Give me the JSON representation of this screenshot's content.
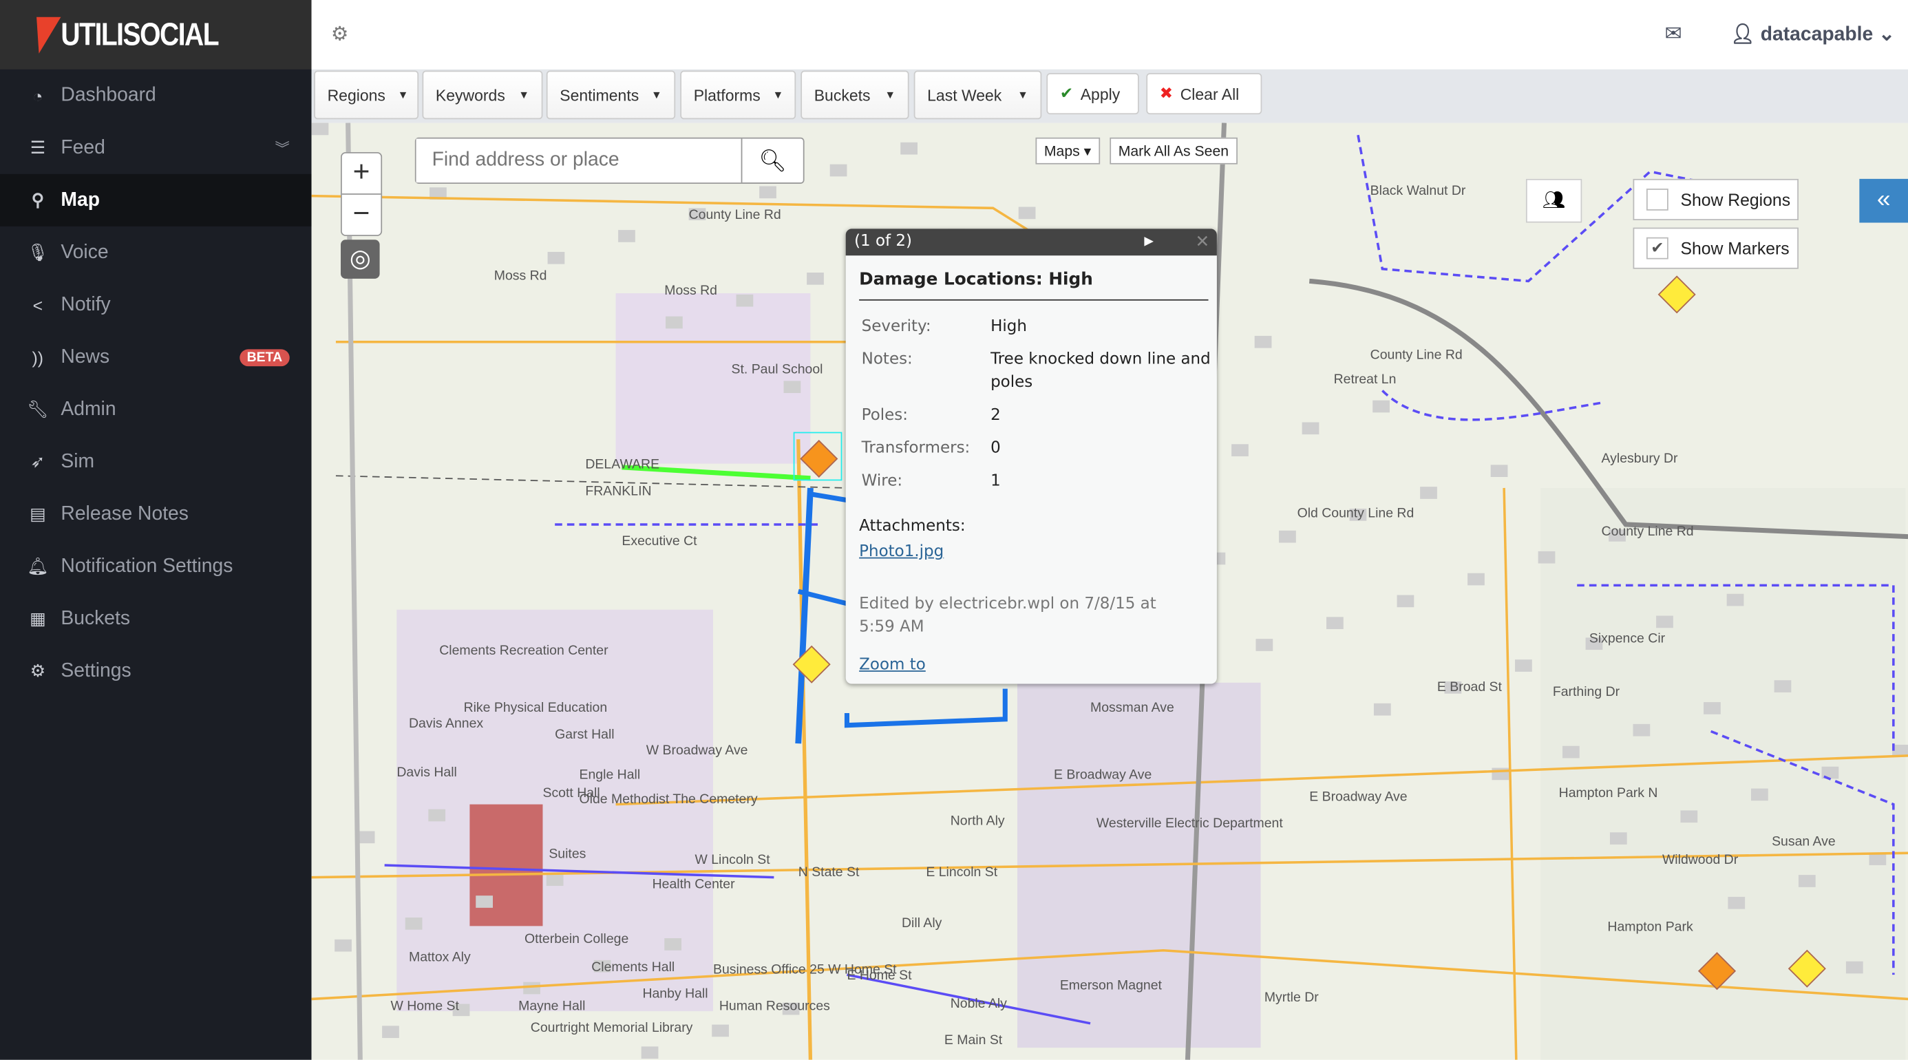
{
  "app": {
    "logo_text": "UTILISOCIAL"
  },
  "sidebar": {
    "items": [
      {
        "label": "Dashboard",
        "icon": "dashboard-icon"
      },
      {
        "label": "Feed",
        "icon": "feed-icon"
      },
      {
        "label": "Map",
        "icon": "map-marker-icon",
        "active": true
      },
      {
        "label": "Voice",
        "icon": "microphone-icon"
      },
      {
        "label": "Notify",
        "icon": "share-icon"
      },
      {
        "label": "News",
        "icon": "rss-icon",
        "badge": "BETA"
      },
      {
        "label": "Admin",
        "icon": "wrench-icon"
      },
      {
        "label": "Sim",
        "icon": "rocket-icon"
      },
      {
        "label": "Release Notes",
        "icon": "newspaper-icon"
      },
      {
        "label": "Notification Settings",
        "icon": "bell-icon"
      },
      {
        "label": "Buckets",
        "icon": "cubes-icon"
      },
      {
        "label": "Settings",
        "icon": "cog-icon"
      }
    ]
  },
  "topbar": {
    "username": "datacapable"
  },
  "filters": {
    "regions": "Regions",
    "keywords": "Keywords",
    "sentiments": "Sentiments",
    "platforms": "Platforms",
    "buckets": "Buckets",
    "period": "Last Week",
    "apply": "Apply",
    "clear": "Clear All"
  },
  "map": {
    "search_placeholder": "Find address or place",
    "maps_button": "Maps",
    "mark_seen": "Mark All As Seen",
    "show_regions": "Show Regions",
    "show_regions_checked": false,
    "show_markers": "Show Markers",
    "show_markers_checked": true,
    "labels": [
      "Moss Rd",
      "Moss Rd",
      "County Line Rd",
      "St. Paul School",
      "DELAWARE",
      "FRANKLIN",
      "Executive Ct",
      "Clements Recreation Center",
      "Rike Physical Education",
      "Davis Annex",
      "Garst Hall",
      "Davis Hall",
      "Scott Hall",
      "Engle Hall",
      "Olde Methodist The Cemetery",
      "Suites",
      "W Broadway Ave",
      "W Lincoln St",
      "Health Center",
      "Otterbein College",
      "Clements Hall",
      "Mayne Hall",
      "Courtright Memorial Library",
      "Hanby Hall",
      "Business Office 25 W Home St",
      "Human Resources",
      "N State St",
      "Mattox Aly",
      "W Home St",
      "Black Walnut Dr",
      "Retreat Ln",
      "County Line Rd",
      "Old County Line Rd",
      "Aylesbury Dr",
      "County Line Rd",
      "E Broad St",
      "Mossman Ave",
      "E Broadway Ave",
      "North Aly",
      "E Lincoln St",
      "Westerville Electric Department",
      "Dill Aly",
      "E Home St",
      "Noble Aly",
      "Emerson Magnet",
      "E Main St",
      "E Broadway Ave",
      "Hampton Park N",
      "Wildwood Dr",
      "Hampton Park",
      "Sixpence Cir",
      "Farthing Dr",
      "Myrtle Dr",
      "Susan Ave"
    ],
    "marker_colors": {
      "high": "#f7941d",
      "medium": "#ffeb3b"
    },
    "line_colors": {
      "primary": "#1a73e8",
      "highlight": "#4cff33",
      "region": "#5b4cf5",
      "road": "#f5b642"
    }
  },
  "popup": {
    "counter": "(1 of 2)",
    "title": "Damage Locations: High",
    "fields": [
      {
        "k": "Severity:",
        "v": "High"
      },
      {
        "k": "Notes:",
        "v": "Tree knocked down line and poles"
      },
      {
        "k": "Poles:",
        "v": "2"
      },
      {
        "k": "Transformers:",
        "v": "0"
      },
      {
        "k": "Wire:",
        "v": "1"
      }
    ],
    "attachments_label": "Attachments:",
    "attachment": "Photo1.jpg",
    "edited": "Edited by electricebr.wpl on 7/8/15 at 5:59 AM",
    "zoom_to": "Zoom to"
  }
}
